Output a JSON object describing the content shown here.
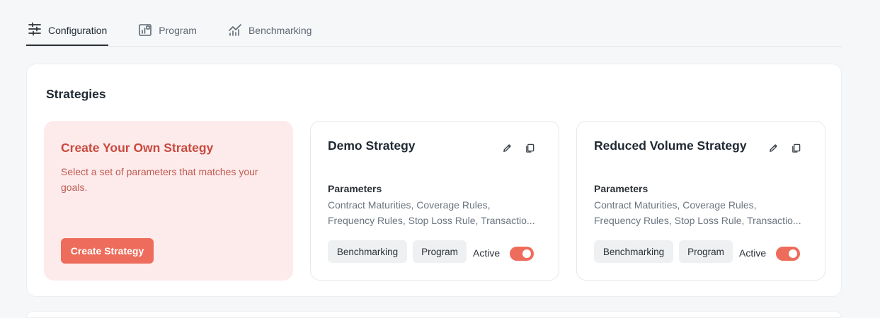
{
  "tabs": [
    {
      "label": "Configuration",
      "icon": "sliders-icon",
      "active": true
    },
    {
      "label": "Program",
      "icon": "program-chart-icon",
      "active": false
    },
    {
      "label": "Benchmarking",
      "icon": "benchmark-chart-icon",
      "active": false
    }
  ],
  "strategies": {
    "title": "Strategies",
    "create_card": {
      "title": "Create Your Own Strategy",
      "description": "Select a set of parameters that matches your goals.",
      "button_label": "Create Strategy"
    },
    "cards": [
      {
        "title": "Demo Strategy",
        "parameters_label": "Parameters",
        "parameters_line1": "Contract Maturities, Coverage Rules,",
        "parameters_line2": "Frequency Rules, Stop Loss Rule, Transactio...",
        "tags": [
          "Benchmarking",
          "Program"
        ],
        "status_label": "Active",
        "active": true
      },
      {
        "title": "Reduced Volume Strategy",
        "parameters_label": "Parameters",
        "parameters_line1": "Contract Maturities, Coverage Rules,",
        "parameters_line2": "Frequency Rules, Stop Loss Rule, Transactio...",
        "tags": [
          "Benchmarking",
          "Program"
        ],
        "status_label": "Active",
        "active": true
      }
    ]
  },
  "colors": {
    "accent": "#ee6c5b",
    "create_card_bg": "#fdebec",
    "create_title": "#c94a3e",
    "page_bg": "#f6f7f9"
  }
}
